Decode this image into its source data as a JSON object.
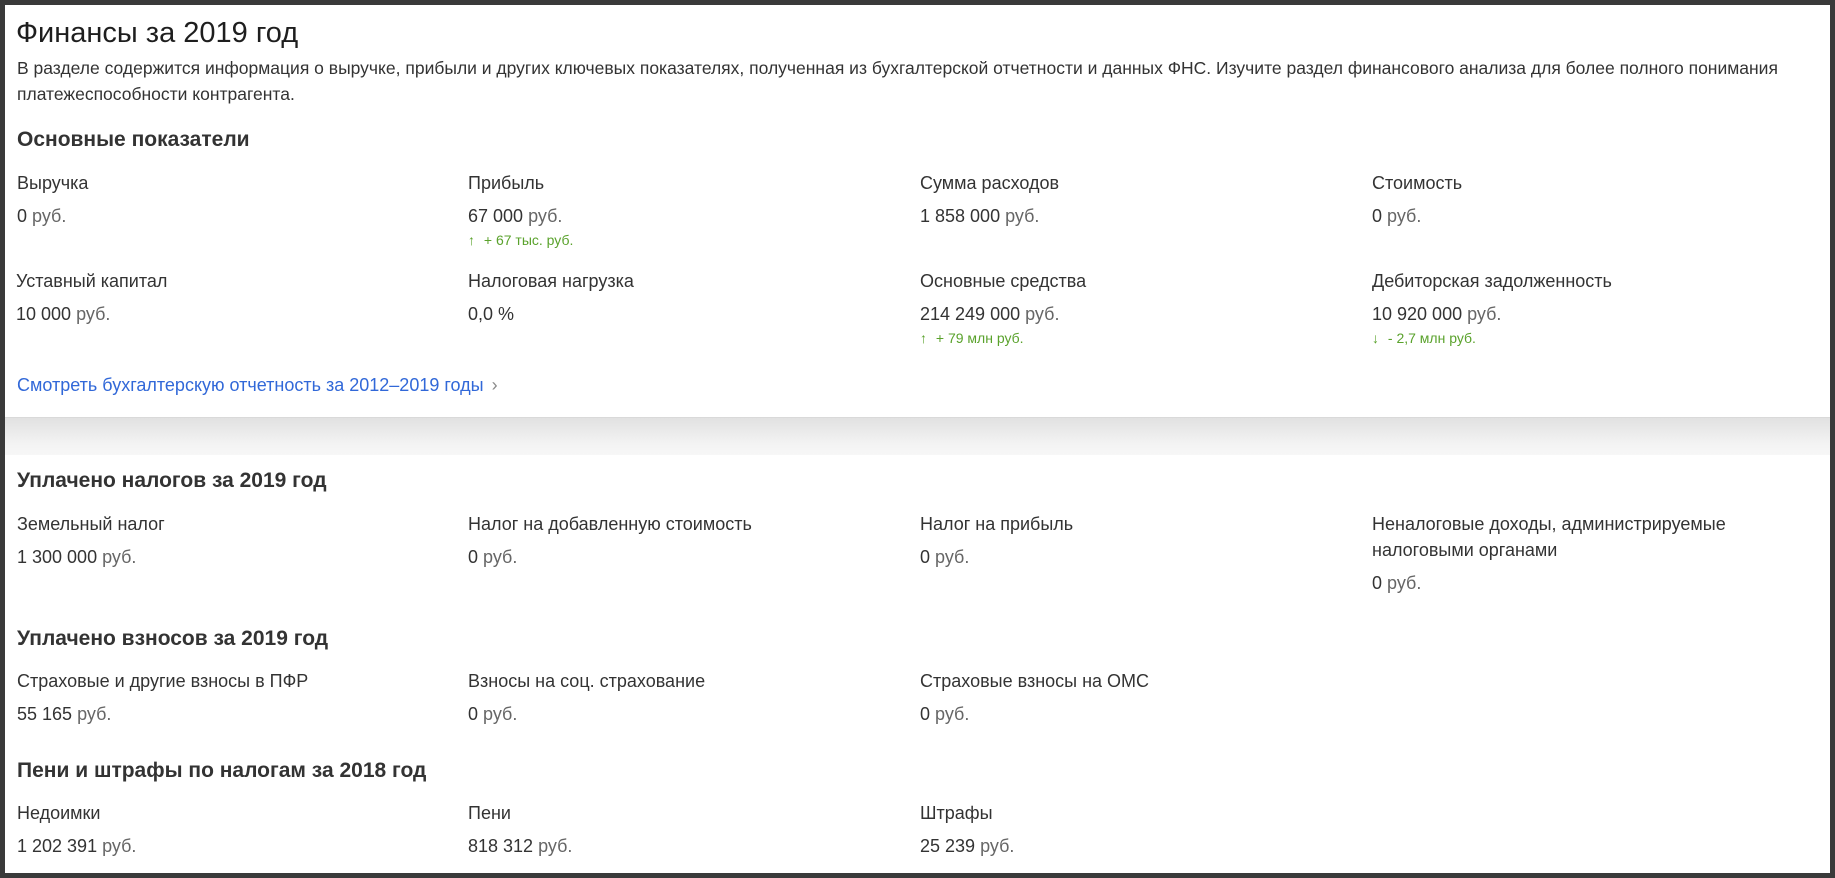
{
  "header": {
    "title": "Финансы за 2019 год",
    "description": "В разделе содержится информация о выручке, прибыли и других ключевых показателях, полученная из бухгалтерской отчетности и данных ФНС. Изучите раздел финансового анализа для более полного понимания платежеспособности контрагента."
  },
  "main_indicators": {
    "title": "Основные показатели",
    "items": [
      {
        "label": "Выручка",
        "value": "0",
        "unit": "руб."
      },
      {
        "label": "Прибыль",
        "value": "67 000",
        "unit": "руб.",
        "delta": "+ 67 тыс. руб.",
        "delta_arrow": "↑"
      },
      {
        "label": "Сумма расходов",
        "value": "1 858 000",
        "unit": "руб."
      },
      {
        "label": "Стоимость",
        "value": "0",
        "unit": "руб."
      },
      {
        "label": "Уставный капитал",
        "value": "10 000",
        "unit": "руб."
      },
      {
        "label": "Налоговая нагрузка",
        "value": "0,0 %",
        "unit": ""
      },
      {
        "label": "Основные средства",
        "value": "214 249 000",
        "unit": "руб.",
        "delta": "+ 79 млн руб.",
        "delta_arrow": "↑"
      },
      {
        "label": "Дебиторская задолженность",
        "value": "10 920 000",
        "unit": "руб.",
        "delta": "- 2,7 млн руб.",
        "delta_arrow": "↓"
      }
    ],
    "link": "Смотреть бухгалтерскую отчетность за 2012–2019 годы",
    "link_chevron": "›"
  },
  "taxes": {
    "title": "Уплачено налогов за 2019 год",
    "items": [
      {
        "label": "Земельный налог",
        "value": "1 300 000",
        "unit": "руб."
      },
      {
        "label": "Налог на добавленную стоимость",
        "value": "0",
        "unit": "руб."
      },
      {
        "label": "Налог на прибыль",
        "value": "0",
        "unit": "руб."
      },
      {
        "label": "Неналоговые доходы, администрируемые налоговыми органами",
        "value": "0",
        "unit": "руб."
      }
    ]
  },
  "contributions": {
    "title": "Уплачено взносов за 2019 год",
    "items": [
      {
        "label": "Страховые и другие взносы в ПФР",
        "value": "55 165",
        "unit": "руб."
      },
      {
        "label": "Взносы на соц. страхование",
        "value": "0",
        "unit": "руб."
      },
      {
        "label": "Страховые взносы на ОМС",
        "value": "0",
        "unit": "руб."
      }
    ]
  },
  "penalties": {
    "title": "Пени и штрафы по налогам за 2018 год",
    "items": [
      {
        "label": "Недоимки",
        "value": "1 202 391",
        "unit": "руб."
      },
      {
        "label": "Пени",
        "value": "818 312",
        "unit": "руб."
      },
      {
        "label": "Штрафы",
        "value": "25 239",
        "unit": "руб."
      }
    ]
  }
}
